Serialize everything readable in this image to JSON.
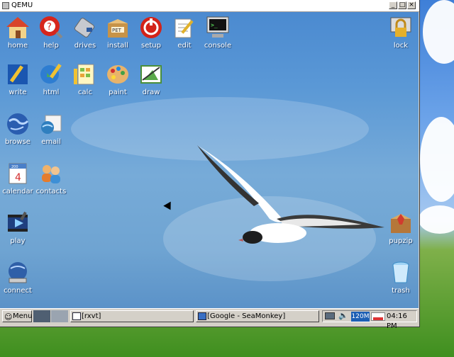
{
  "window": {
    "title": "QEMU",
    "minimize": "_",
    "maximize": "□",
    "close": "×"
  },
  "desktop": {
    "icons": [
      {
        "label": "home"
      },
      {
        "label": "help"
      },
      {
        "label": "drives"
      },
      {
        "label": "install"
      },
      {
        "label": "setup"
      },
      {
        "label": "edit"
      },
      {
        "label": "console"
      },
      {
        "label": "lock"
      },
      {
        "label": "write"
      },
      {
        "label": "html"
      },
      {
        "label": "calc"
      },
      {
        "label": "paint"
      },
      {
        "label": "draw"
      },
      {
        "label": "browse"
      },
      {
        "label": "email"
      },
      {
        "label": "calendar"
      },
      {
        "label": "contacts"
      },
      {
        "label": "play"
      },
      {
        "label": "pupzip"
      },
      {
        "label": "connect"
      },
      {
        "label": "trash"
      }
    ],
    "install_badge": "PET",
    "calendar_day": "4",
    "calendar_year": "200"
  },
  "taskbar": {
    "menu_label": "Menu",
    "tasks": [
      {
        "label": "[rxvt]"
      },
      {
        "label": "[Google - SeaMonkey]"
      }
    ],
    "memory": "120M",
    "clock": "04:16 PM"
  }
}
